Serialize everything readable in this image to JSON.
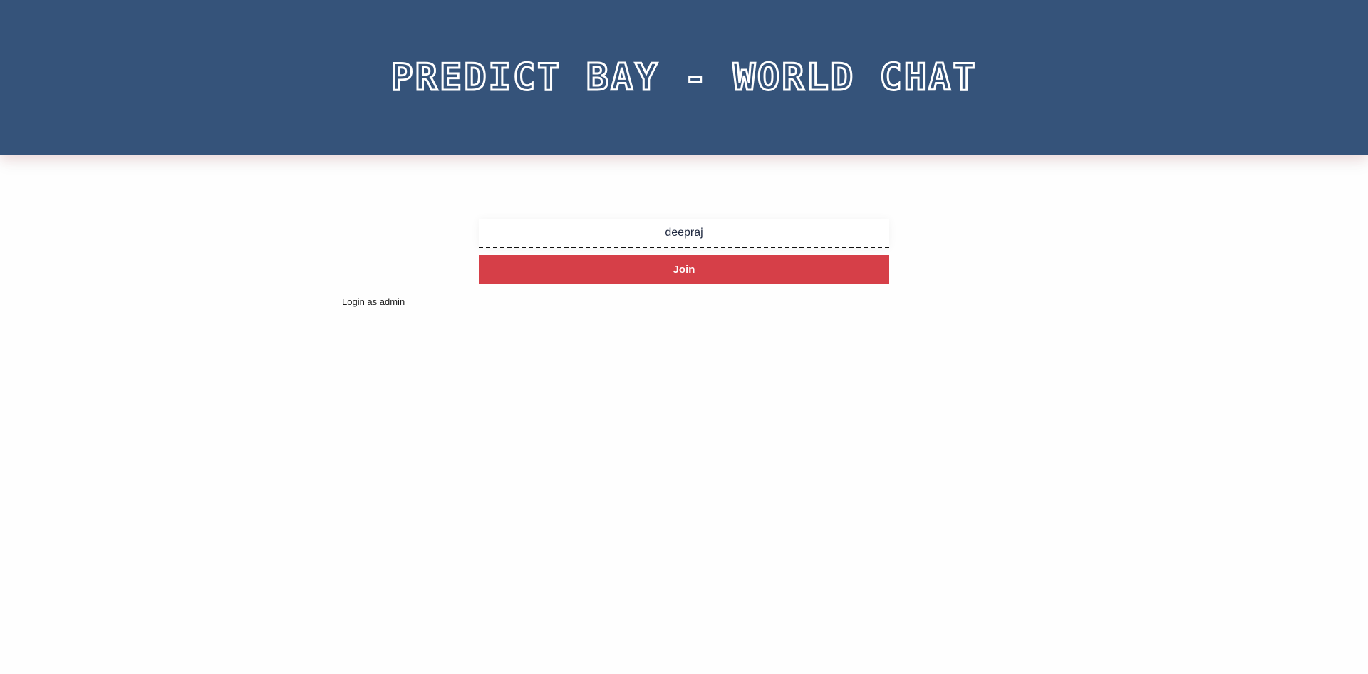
{
  "header": {
    "title": "PREDICT BAY - WORLD CHAT"
  },
  "join_form": {
    "name_value": "deepraj",
    "join_label": "Join"
  },
  "admin": {
    "link_label": "Login as admin"
  },
  "colors": {
    "header_background": "#35537a",
    "join_button": "#d63f48",
    "title_outline": "#ffffff"
  }
}
